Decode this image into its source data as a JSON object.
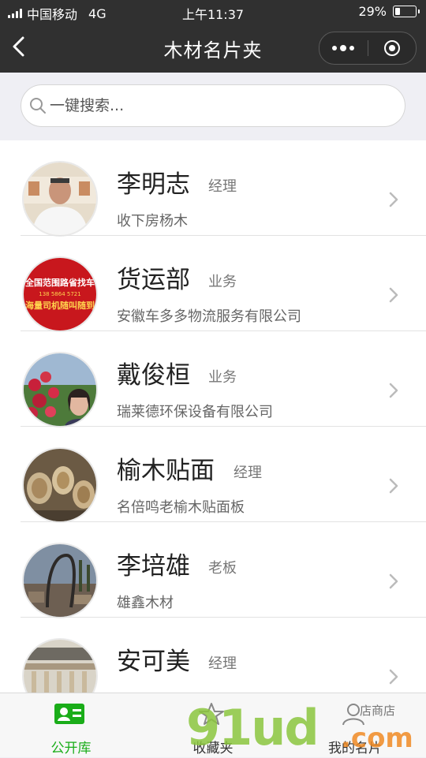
{
  "status": {
    "carrier": "中国移动",
    "network": "4G",
    "time": "上午11:37",
    "battery": "29%",
    "battery_level": 0.29
  },
  "nav": {
    "title": "木材名片夹"
  },
  "search": {
    "placeholder": "一键搜索..."
  },
  "cards": [
    {
      "name": "李明志",
      "role": "经理",
      "company": "收下房杨木"
    },
    {
      "name": "货运部",
      "role": "业务",
      "company": "安徽车多多物流服务有限公司",
      "avatar_text_1": "全国范围路省找车",
      "avatar_text_2": "138 5864 5721",
      "avatar_text_3": "海量司机随叫随到"
    },
    {
      "name": "戴俊桓",
      "role": "业务",
      "company": "瑞莱德环保设备有限公司"
    },
    {
      "name": "榆木贴面",
      "role": "经理",
      "company": "名倍鸣老榆木贴面板"
    },
    {
      "name": "李培雄",
      "role": "老板",
      "company": "雄鑫木材"
    },
    {
      "name": "安可美",
      "role": "经理",
      "company": ""
    }
  ],
  "tabs": [
    {
      "label": "公开库",
      "active": true
    },
    {
      "label": "收藏夹",
      "active": false
    },
    {
      "label": "我的名片",
      "active": false
    }
  ],
  "watermark": {
    "main": "91ud",
    "suffix": ".com",
    "stamp": "店商店"
  },
  "colors": {
    "accent": "#1aad19",
    "bar": "#303030"
  }
}
